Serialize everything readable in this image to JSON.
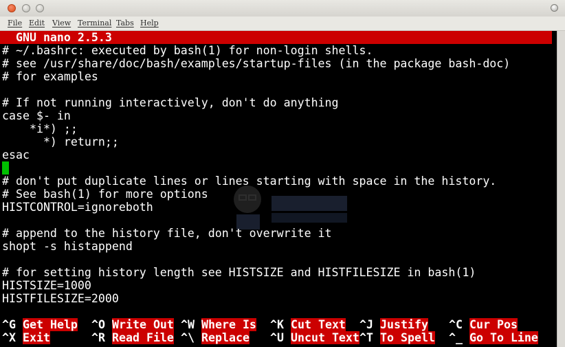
{
  "menubar": {
    "items": [
      "File",
      "Edit",
      "View",
      "Terminal",
      "Tabs",
      "Help"
    ]
  },
  "nano": {
    "header": "  GNU nano 2.5.3",
    "lines": [
      "# ~/.bashrc: executed by bash(1) for non-login shells.",
      "# see /usr/share/doc/bash/examples/startup-files (in the package bash-doc)",
      "# for examples",
      "",
      "# If not running interactively, don't do anything",
      "case $- in",
      "    *i*) ;;",
      "      *) return;;",
      "esac",
      "",
      "# don't put duplicate lines or lines starting with space in the history.",
      "# See bash(1) for more options",
      "HISTCONTROL=ignoreboth",
      "",
      "# append to the history file, don't overwrite it",
      "shopt -s histappend",
      "",
      "# for setting history length see HISTSIZE and HISTFILESIZE in bash(1)",
      "HISTSIZE=1000",
      "HISTFILESIZE=2000"
    ],
    "shortcuts_row1": [
      {
        "key": "^G",
        "label": "Get Help"
      },
      {
        "key": "^O",
        "label": "Write Out"
      },
      {
        "key": "^W",
        "label": "Where Is"
      },
      {
        "key": "^K",
        "label": "Cut Text"
      },
      {
        "key": "^J",
        "label": "Justify"
      },
      {
        "key": "^C",
        "label": "Cur Pos"
      }
    ],
    "shortcuts_row2": [
      {
        "key": "^X",
        "label": "Exit"
      },
      {
        "key": "^R",
        "label": "Read File"
      },
      {
        "key": "^\\",
        "label": "Replace"
      },
      {
        "key": "^U",
        "label": "Uncut Text"
      },
      {
        "key": "^T",
        "label": "To Spell"
      },
      {
        "key": "^_",
        "label": "Go To Line"
      }
    ]
  },
  "colors": {
    "header_bg": "#cc0000",
    "cursor": "#00c000",
    "terminal_bg": "#000000",
    "terminal_fg": "#ffffff"
  },
  "icons": [
    "window-close-icon",
    "window-minimize-icon",
    "window-maximize-icon",
    "scroll-up-icon"
  ]
}
